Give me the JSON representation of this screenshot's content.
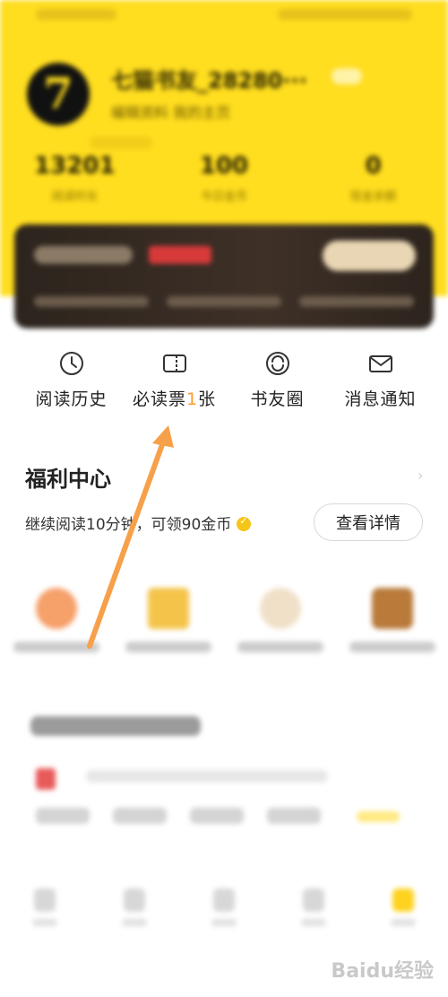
{
  "header": {
    "username": "七猫书友_28280···",
    "user_sub": "编辑资料   我的主页",
    "stats": [
      {
        "num": "13201",
        "label": "阅读时长"
      },
      {
        "num": "100",
        "label": "今日金币"
      },
      {
        "num": "0",
        "label": "现金余额"
      }
    ]
  },
  "quick_entries": [
    {
      "label_before": "阅读历史",
      "highlight": "",
      "label_after": "",
      "icon": "clock-icon"
    },
    {
      "label_before": "必读票",
      "highlight": "1",
      "label_after": "张",
      "icon": "book-ticket-icon"
    },
    {
      "label_before": "书友圈",
      "highlight": "",
      "label_after": "",
      "icon": "friends-circle-icon"
    },
    {
      "label_before": "消息通知",
      "highlight": "",
      "label_after": "",
      "icon": "mail-icon"
    }
  ],
  "welfare": {
    "title": "福利中心",
    "desc": "继续阅读10分钟，可领90金币",
    "button": "查看详情"
  },
  "watermark": "Baidu经验",
  "colors": {
    "header_yellow": "#ffdd1f",
    "highlight_orange": "#ff9a2c",
    "arrow_orange": "#f7a04a"
  }
}
